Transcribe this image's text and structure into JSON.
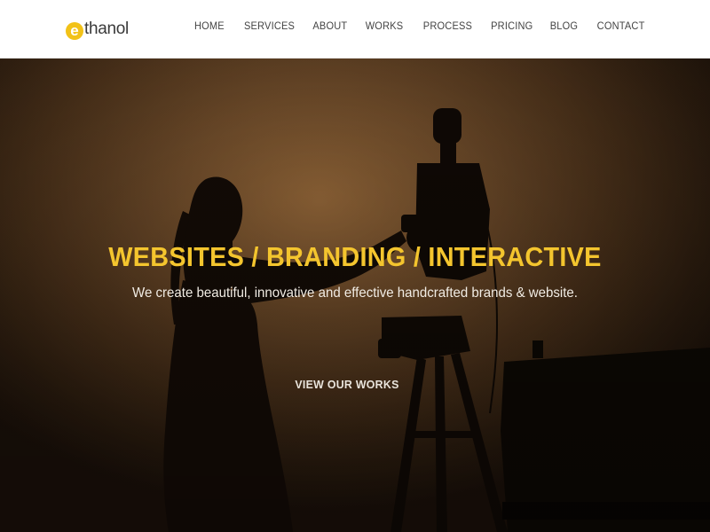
{
  "header": {
    "logo": {
      "letter": "e",
      "rest": "thanol",
      "accent": "#f2c218"
    },
    "nav": [
      {
        "label": "HOME"
      },
      {
        "label": "SERVICES"
      },
      {
        "label": "ABOUT"
      },
      {
        "label": "WORKS"
      },
      {
        "label": "PROCESS"
      },
      {
        "label": "PRICING"
      },
      {
        "label": "BLOG"
      },
      {
        "label": "CONTACT"
      }
    ]
  },
  "hero": {
    "title": "WEBSITES / BRANDING / INTERACTIVE",
    "subtitle": "We create beautiful, innovative and effective handcrafted brands & website.",
    "cta_label": "VIEW OUR WORKS",
    "title_color": "#f4c52e"
  }
}
